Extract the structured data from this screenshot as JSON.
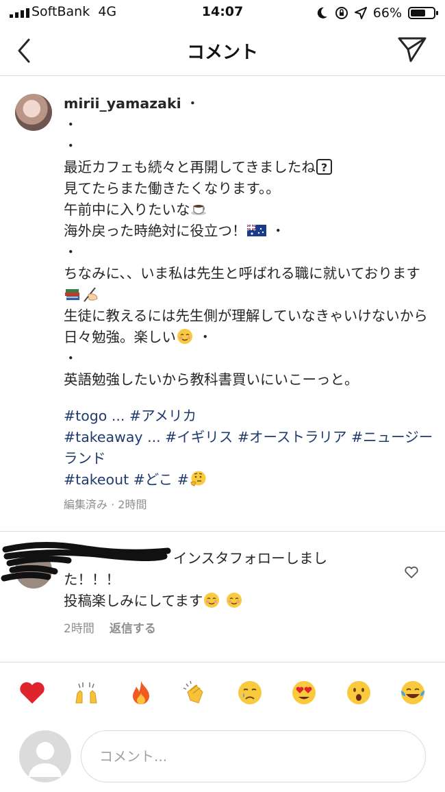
{
  "status_bar": {
    "carrier": "SoftBank",
    "network": "4G",
    "time": "14:07",
    "battery": "66%",
    "battery_level": 0.66
  },
  "nav": {
    "title": "コメント",
    "back_icon": "chevron-left-icon",
    "send_icon": "paper-plane-icon"
  },
  "post": {
    "username": "mirii_yamazaki",
    "after_username": " ・",
    "lines": [
      "・",
      "・",
      "最近カフェも続々と再開してきましたね",
      "見てたらまた働きたくなります。。",
      "午前中に入りたいな",
      "海外戻った時絶対に役立つ！",
      "・",
      "ちなみに、、いま私は先生と呼ばれる職に就いております",
      "生徒に教えるには先生側が理解していなきゃいけないから日々勉強。楽しい",
      "・",
      "英語勉強したいから教科書買いにいこーっと。"
    ],
    "line6_suffix": " ・",
    "line9_suffix": " ・",
    "hashtags": [
      "#togo ... #アメリカ",
      "#takeaway ... #イギリス #オーストラリア #ニュージーランド",
      "#takeout #どこ #"
    ],
    "meta": "編集済み · 2時間",
    "emoji": [
      "question-box-icon",
      "coffee-icon",
      "australia-flag-icon",
      "books-icon",
      "writing-hand-icon",
      "smiling-face-icon",
      "thinking-face-icon"
    ]
  },
  "comment": {
    "username": "",
    "text_line1": "インスタフォローしまし",
    "text_line2": "た！！！",
    "text_line3": "投稿楽しみにしてます",
    "time": "2時間",
    "reply": "返信する",
    "emoji": [
      "smiling-face-icon",
      "smiling-face-icon"
    ],
    "like_icon": "heart-outline-icon"
  },
  "reactions": [
    "red-heart",
    "raising-hands",
    "fire",
    "clapping-hands",
    "crying-face",
    "heart-eyes",
    "surprised-face",
    "tears-of-joy"
  ],
  "input": {
    "placeholder": "コメント..."
  },
  "colors": {
    "hashtag": "#1f3b6e",
    "meta": "#8e8e8e",
    "divider": "#dbdbdb"
  }
}
